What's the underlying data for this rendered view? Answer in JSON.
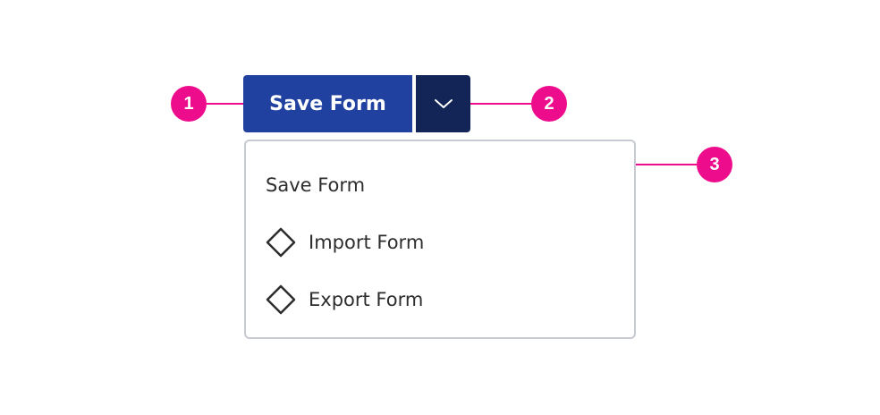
{
  "split_button": {
    "main_label": "Save Form",
    "toggle_icon": "chevron-down-icon"
  },
  "menu": {
    "items": [
      {
        "label": "Save Form",
        "icon": ""
      },
      {
        "label": "Import Form",
        "icon": "diamond-icon"
      },
      {
        "label": "Export Form",
        "icon": "diamond-icon"
      }
    ]
  },
  "callouts": [
    {
      "number": "1"
    },
    {
      "number": "2"
    },
    {
      "number": "3"
    }
  ],
  "colors": {
    "primary": "#2141a0",
    "primary_dark": "#132456",
    "callout": "#ec0c8c",
    "menu_border": "#c7cad3",
    "menu_text": "#2d2d2d"
  }
}
